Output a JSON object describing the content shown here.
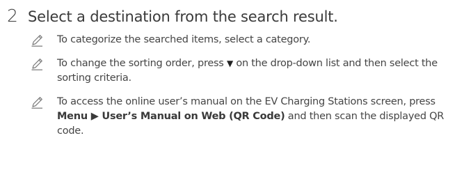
{
  "step": {
    "number": "2",
    "title": "Select a destination from the search result."
  },
  "notes": [
    {
      "icon": "pencil-note-icon",
      "text": "To categorize the searched items, select a category."
    },
    {
      "icon": "pencil-note-icon",
      "text_before": "To change the sorting order, press ",
      "symbol": "▼",
      "text_after": " on the drop-down list and then select the sorting criteria."
    },
    {
      "icon": "pencil-note-icon",
      "text_before": "To access the online user’s manual on the EV Charging Stations screen, press ",
      "bold_menu": "Menu",
      "arrow": " ▶ ",
      "bold_item": "User’s Manual on Web (QR Code)",
      "text_after": " and then scan the displayed QR code."
    }
  ]
}
